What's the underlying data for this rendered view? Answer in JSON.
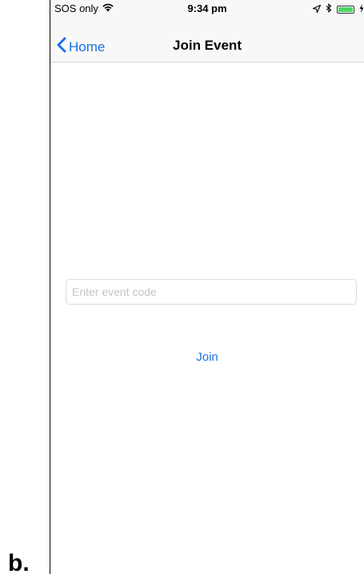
{
  "figure_label": "b.",
  "status_bar": {
    "carrier": "SOS only",
    "time": "9:34 pm",
    "battery_level": 1.0,
    "battery_color": "#4cd964",
    "icons": [
      "wifi-icon",
      "location-arrow-icon",
      "bluetooth-icon",
      "battery-icon",
      "charging-icon"
    ]
  },
  "nav": {
    "back_label": "Home",
    "title": "Join Event"
  },
  "form": {
    "event_code_value": "",
    "event_code_placeholder": "Enter event code",
    "join_label": "Join"
  },
  "colors": {
    "accent": "#1a73e8",
    "nav_background": "#f8f8f8",
    "placeholder": "#c4c4c8"
  }
}
